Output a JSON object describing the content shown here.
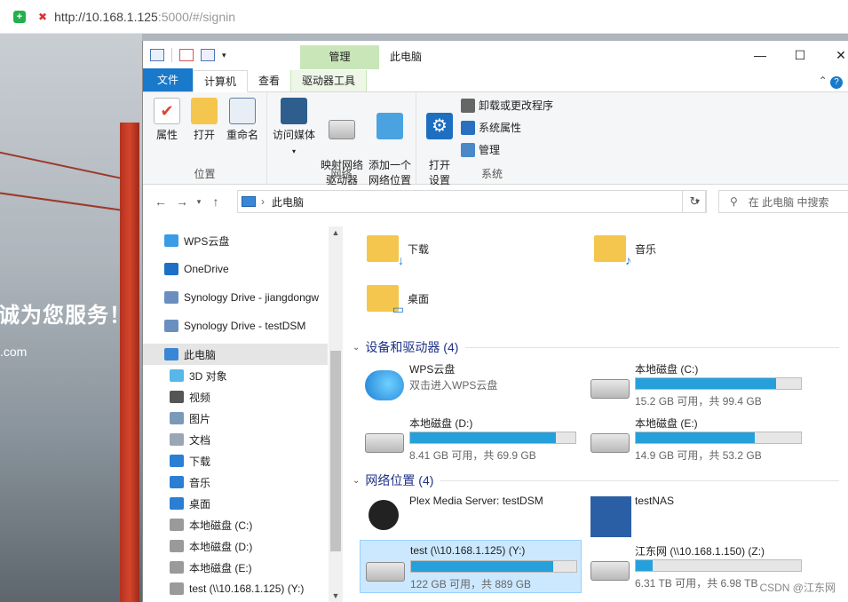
{
  "browser": {
    "url_host": "http://10.168.1.125",
    "url_rest": ":5000/#/signin"
  },
  "background": {
    "slogan": "诚为您服务！",
    "domain": ".com"
  },
  "window": {
    "title": "此电脑",
    "context_tab": "管理",
    "controls": [
      "—",
      "☐",
      "✕"
    ]
  },
  "ribbon_tabs": {
    "file": "文件",
    "computer": "计算机",
    "view": "查看",
    "drive_tools": "驱动器工具"
  },
  "ribbon": {
    "location": {
      "label": "位置",
      "properties": "属性",
      "open": "打开",
      "rename": "重命名"
    },
    "network": {
      "label": "网络",
      "media": "访问媒体",
      "map_drive": "映射网络\n驱动器",
      "add_location": "添加一个\n网络位置"
    },
    "system": {
      "label": "系统",
      "open_settings": "打开\n设置",
      "uninstall": "卸载或更改程序",
      "sys_props": "系统属性",
      "manage": "管理"
    }
  },
  "address": {
    "path": "此电脑",
    "search_placeholder": "在 此电脑 中搜索"
  },
  "nav_items": [
    {
      "label": "WPS云盘",
      "icon": "cloud-icon",
      "color": "#3a9be6"
    },
    {
      "label": "OneDrive",
      "icon": "onedrive-icon",
      "color": "#1f6fc5"
    },
    {
      "label": "Synology Drive - jiangdongw",
      "icon": "synology-drive-icon",
      "color": "#6a8fbf"
    },
    {
      "label": "Synology Drive - testDSM",
      "icon": "synology-drive-icon",
      "color": "#6a8fbf"
    },
    {
      "label": "此电脑",
      "icon": "computer-icon",
      "color": "#3a86d6"
    },
    {
      "label": "3D 对象",
      "icon": "cube-icon",
      "color": "#58b6e8"
    },
    {
      "label": "视频",
      "icon": "video-icon",
      "color": "#555555"
    },
    {
      "label": "图片",
      "icon": "picture-icon",
      "color": "#7a9ab8"
    },
    {
      "label": "文档",
      "icon": "document-icon",
      "color": "#9aa6b4"
    },
    {
      "label": "下载",
      "icon": "download-icon",
      "color": "#2a7fd4"
    },
    {
      "label": "音乐",
      "icon": "music-icon",
      "color": "#2a7fd4"
    },
    {
      "label": "桌面",
      "icon": "desktop-icon",
      "color": "#2a7fd4"
    },
    {
      "label": "本地磁盘 (C:)",
      "icon": "drive-icon",
      "color": "#9a9a9a"
    },
    {
      "label": "本地磁盘 (D:)",
      "icon": "drive-icon",
      "color": "#9a9a9a"
    },
    {
      "label": "本地磁盘 (E:)",
      "icon": "drive-icon",
      "color": "#9a9a9a"
    },
    {
      "label": "test (\\\\10.168.1.125) (Y:)",
      "icon": "network-drive-icon",
      "color": "#9a9a9a"
    }
  ],
  "folders": [
    {
      "label": "下载",
      "overlay": "↓"
    },
    {
      "label": "音乐",
      "overlay": "♪"
    },
    {
      "label": "桌面",
      "overlay": "▭"
    }
  ],
  "sections": {
    "devices": "设备和驱动器 (4)",
    "network": "网络位置 (4)"
  },
  "devices": [
    {
      "name": "WPS云盘",
      "sub": "双击进入WPS云盘",
      "icon": "wps-cloud-icon",
      "fill": null
    },
    {
      "name": "本地磁盘 (C:)",
      "sub": "15.2 GB 可用，共 99.4 GB",
      "icon": "windows-drive-icon",
      "fill": 0.85
    },
    {
      "name": "本地磁盘 (D:)",
      "sub": "8.41 GB 可用，共 69.9 GB",
      "icon": "drive-icon",
      "fill": 0.88
    },
    {
      "name": "本地磁盘 (E:)",
      "sub": "14.9 GB 可用，共 53.2 GB",
      "icon": "drive-icon",
      "fill": 0.72
    }
  ],
  "network_locations": [
    {
      "name": "Plex Media Server: testDSM",
      "sub": "",
      "icon": "plex-icon",
      "fill": null
    },
    {
      "name": "testNAS",
      "sub": "",
      "icon": "synology-icon",
      "fill": null
    },
    {
      "name": "test (\\\\10.168.1.125) (Y:)",
      "sub": "122 GB 可用，共 889 GB",
      "icon": "network-drive-icon",
      "fill": 0.86
    },
    {
      "name": "江东网 (\\\\10.168.1.150) (Z:)",
      "sub": "6.31 TB 可用，共 6.98 TB",
      "icon": "network-drive-icon",
      "fill": 0.1
    }
  ],
  "watermark": "CSDN @江东网",
  "colors": {
    "accent": "#1979ca",
    "bar": "#26a0da",
    "context": "#c8e6b8"
  }
}
